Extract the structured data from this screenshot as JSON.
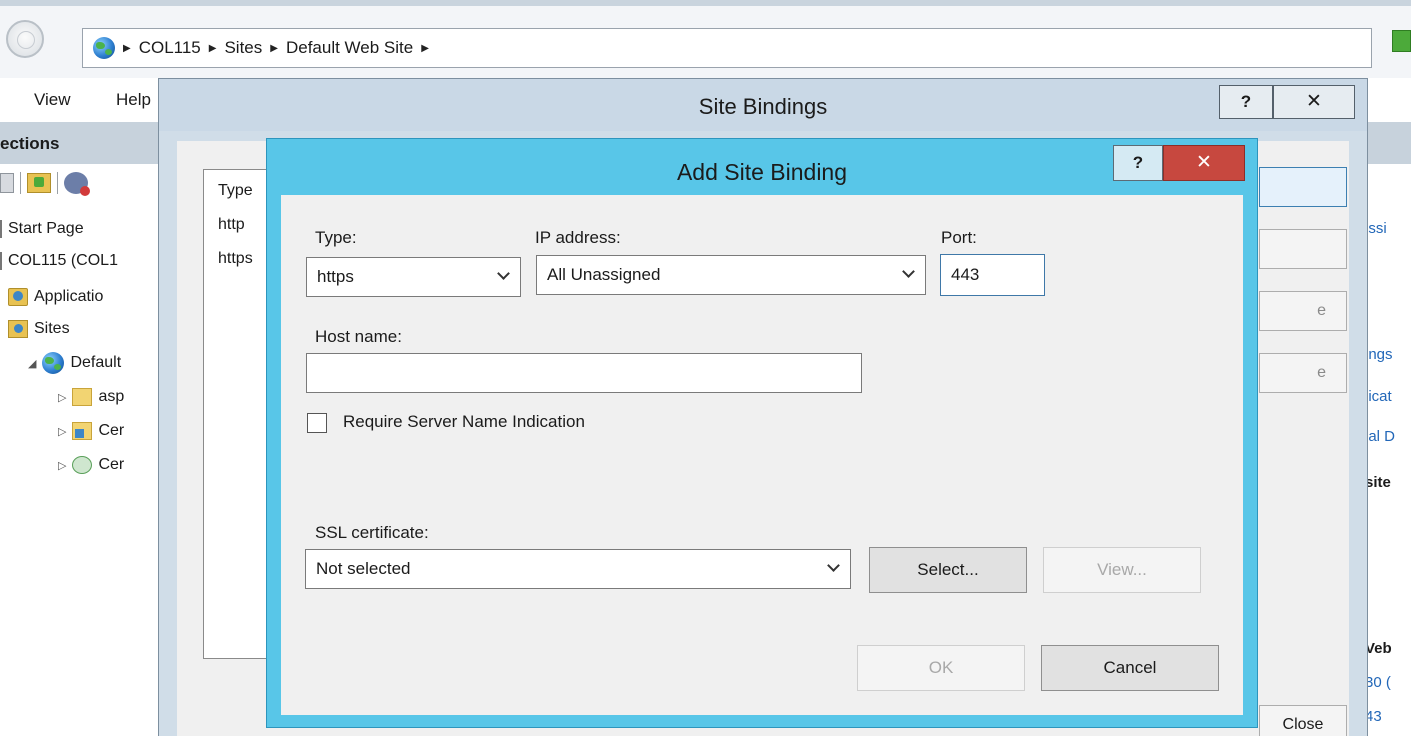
{
  "address_bar": {
    "crumbs": [
      "COL115",
      "Sites",
      "Default Web Site"
    ]
  },
  "menu": {
    "view": "View",
    "help": "Help"
  },
  "connections": {
    "title": "ections",
    "tree": {
      "start_page": "Start Page",
      "server": "COL115 (COL1",
      "app_pools": "Applicatio",
      "sites": "Sites",
      "default_site": "Default",
      "child1": "asp",
      "child2": "Cer",
      "child3": "Cer"
    }
  },
  "actions_panel": {
    "link1": "issi",
    "link2": "ings",
    "link3": "licat",
    "link4": "ial D",
    "bold1": "site",
    "bold2": "Veb",
    "link5": "30 (",
    "link6": "43"
  },
  "site_bindings": {
    "title": "Site Bindings",
    "help": "?",
    "close": "✕",
    "list_header": "Type",
    "rows": [
      "http",
      "https"
    ],
    "btn_edit_partial": "e",
    "btn_remove_partial": "e",
    "btn_close": "Close"
  },
  "add_binding": {
    "title": "Add Site Binding",
    "help": "?",
    "close": "✕",
    "type_label": "Type:",
    "type_value": "https",
    "ip_label": "IP address:",
    "ip_value": "All Unassigned",
    "port_label": "Port:",
    "port_value": "443",
    "host_label": "Host name:",
    "host_value": "",
    "sni_label": "Require Server Name Indication",
    "sni_checked": false,
    "ssl_label": "SSL certificate:",
    "ssl_value": "Not selected",
    "select_btn": "Select...",
    "view_btn": "View...",
    "ok_btn": "OK",
    "cancel_btn": "Cancel"
  }
}
